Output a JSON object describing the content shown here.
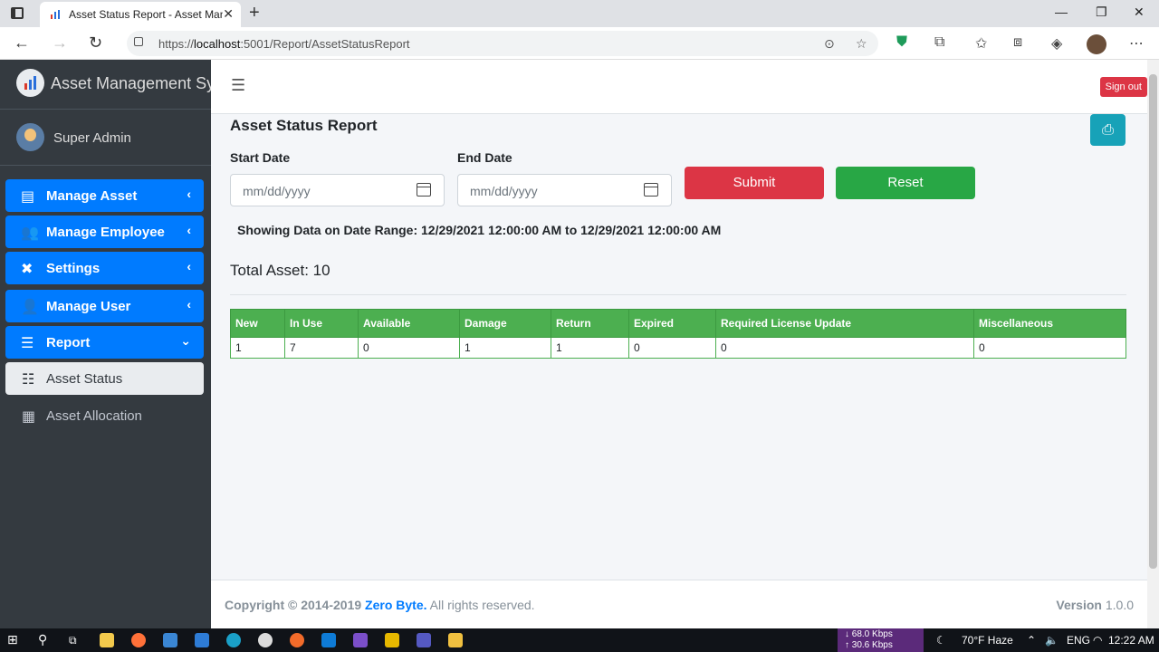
{
  "browser": {
    "tab_title": "Asset Status Report - Asset Management System",
    "url_prefix": "https://",
    "url_host": "localhost",
    "url_rest": ":5001/Report/AssetStatusReport"
  },
  "sidebar": {
    "brand": "Asset Management Sys",
    "user_name": "Super Admin",
    "items": [
      {
        "label": "Manage Asset",
        "icon": "box-icon"
      },
      {
        "label": "Manage Employee",
        "icon": "users-icon"
      },
      {
        "label": "Settings",
        "icon": "tools-icon"
      },
      {
        "label": "Manage User",
        "icon": "user-cog-icon"
      },
      {
        "label": "Report",
        "icon": "database-icon"
      }
    ],
    "sub_items": [
      {
        "label": "Asset Status",
        "icon": "list-icon"
      },
      {
        "label": "Asset Allocation",
        "icon": "table-icon"
      }
    ]
  },
  "topnav": {
    "signout_label": "Sign out"
  },
  "main": {
    "title": "Asset Status Report",
    "start_label": "Start Date",
    "end_label": "End Date",
    "date_placeholder": "mm/dd/yyyy",
    "submit_label": "Submit",
    "reset_label": "Reset",
    "range_text": "Showing Data on Date Range: 12/29/2021 12:00:00 AM to 12/29/2021 12:00:00 AM",
    "total_text": "Total Asset: 10",
    "table": {
      "headers": [
        "New",
        "In Use",
        "Available",
        "Damage",
        "Return",
        "Expired",
        "Required License Update",
        "Miscellaneous"
      ],
      "row": [
        "1",
        "7",
        "0",
        "1",
        "1",
        "0",
        "0",
        "0"
      ]
    }
  },
  "footer": {
    "copy_prefix": "Copyright © 2014-2019 ",
    "company": "Zero Byte.",
    "copy_suffix": " All rights reserved.",
    "version_label": "Version",
    "version_value": "1.0.0"
  },
  "taskbar": {
    "net_down": "68.0 Kbps",
    "net_up": "30.6 Kbps",
    "weather": "70°F  Haze",
    "time": "12:22 AM"
  },
  "colors": {
    "primary": "#007bff",
    "danger": "#dc3545",
    "success": "#28a745",
    "table_header": "#4caf50",
    "sidebar_bg": "#343a40",
    "info": "#17a2b8"
  }
}
